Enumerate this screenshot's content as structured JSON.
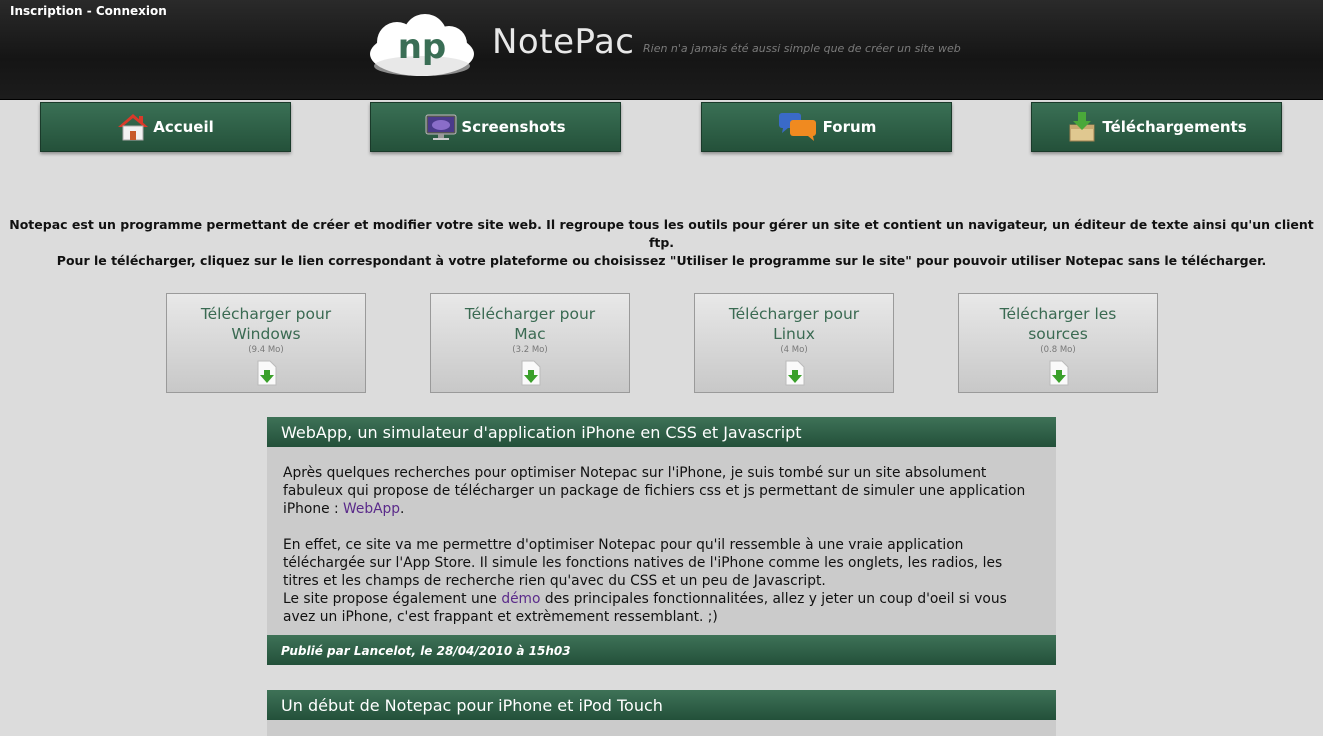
{
  "header": {
    "auth_inscription": "Inscription",
    "auth_sep": " - ",
    "auth_connexion": "Connexion",
    "logo_text": "np",
    "brand": "NotePac",
    "tagline": "Rien n'a jamais été aussi simple que de créer un site web"
  },
  "nav": [
    {
      "label": "Accueil",
      "icon": "home-icon"
    },
    {
      "label": "Screenshots",
      "icon": "monitor-icon"
    },
    {
      "label": "Forum",
      "icon": "chat-bubbles-icon"
    },
    {
      "label": "Téléchargements",
      "icon": "download-box-icon"
    }
  ],
  "intro": {
    "line1": "Notepac est un programme permettant de créer et modifier votre site web. Il regroupe tous les outils pour gérer un site et contient un navigateur, un éditeur de texte ainsi qu'un client ftp.",
    "line2": "Pour le télécharger, cliquez sur le lien correspondant à votre plateforme ou choisissez \"Utiliser le programme sur le site\" pour pouvoir utiliser Notepac sans le télécharger."
  },
  "downloads": [
    {
      "line1": "Télécharger pour",
      "line2": "Windows",
      "size": "(9.4 Mo)"
    },
    {
      "line1": "Télécharger pour",
      "line2": "Mac",
      "size": "(3.2 Mo)"
    },
    {
      "line1": "Télécharger pour",
      "line2": "Linux",
      "size": "(4 Mo)"
    },
    {
      "line1": "Télécharger les",
      "line2": "sources",
      "size": "(0.8 Mo)"
    }
  ],
  "articles": [
    {
      "title": "WebApp, un simulateur d'application iPhone en CSS et Javascript",
      "p1_text": "Après quelques recherches pour optimiser Notepac sur l'iPhone, je suis tombé sur un site absolument fabuleux qui propose de télécharger un package de fichiers css et js permettant de simuler une application iPhone : ",
      "p1_link": "WebApp",
      "p1_end": ".",
      "p2": "En effet, ce site va me permettre d'optimiser Notepac pour qu'il ressemble à une vraie application téléchargée sur l'App Store. Il simule les fonctions natives de l'iPhone comme les onglets, les radios, les titres et les champs de recherche rien qu'avec du CSS et un peu de Javascript.",
      "p3_start": "Le site propose également une ",
      "p3_link": "démo",
      "p3_end": " des principales fonctionnalitées, allez y jeter un coup d'oeil si vous avez un iPhone, c'est frappant et extrèmement ressemblant. ;)",
      "footer": "Publié par Lancelot, le 28/04/2010 à 15h03"
    },
    {
      "title": "Un début de Notepac pour iPhone et iPod Touch"
    }
  ],
  "colors": {
    "header_bg": "#1c1c1c",
    "nav_green": "#2f6048",
    "page_bg": "#dcdcdc",
    "link_purple": "#5a2a8a"
  }
}
